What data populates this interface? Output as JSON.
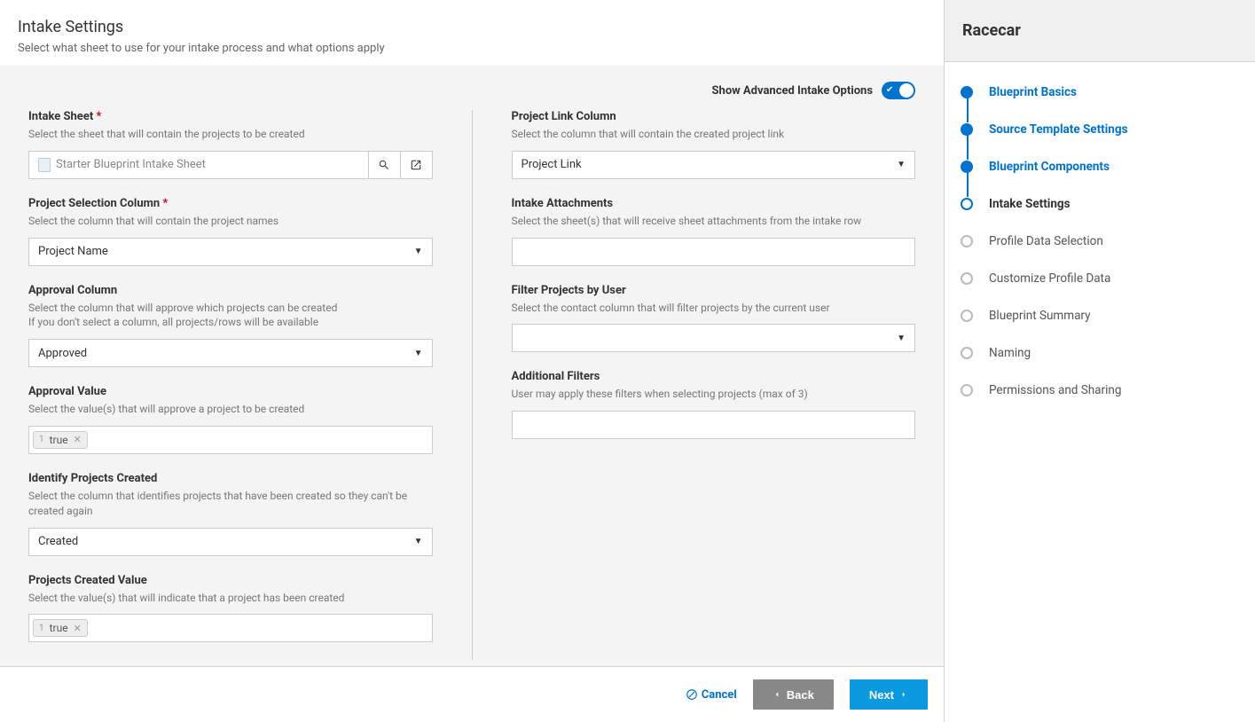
{
  "header": {
    "title": "Intake Settings",
    "subtitle": "Select what sheet to use for your intake process and what options apply"
  },
  "advanced_toggle": {
    "label": "Show Advanced Intake Options",
    "enabled": true
  },
  "left": {
    "intake_sheet": {
      "label": "Intake Sheet",
      "required": true,
      "help": "Select the sheet that will contain the projects to be created",
      "value": "Starter Blueprint Intake Sheet"
    },
    "project_selection": {
      "label": "Project Selection Column",
      "required": true,
      "help": "Select the column that will contain the project names",
      "value": "Project Name"
    },
    "approval_column": {
      "label": "Approval Column",
      "help1": "Select the column that will approve which projects can be created",
      "help2": "If you don't select a column, all projects/rows will be available",
      "value": "Approved"
    },
    "approval_value": {
      "label": "Approval Value",
      "help": "Select the value(s) that will approve a project to be created",
      "tag_num": "1",
      "tag_text": "true"
    },
    "identify_created": {
      "label": "Identify Projects Created",
      "help": "Select the column that identifies projects that have been created so they can't be created again",
      "value": "Created"
    },
    "created_value": {
      "label": "Projects Created Value",
      "help": "Select the value(s) that will indicate that a project has been created",
      "tag_num": "1",
      "tag_text": "true"
    }
  },
  "right": {
    "project_link": {
      "label": "Project Link Column",
      "help": "Select the column that will contain the created project link",
      "value": "Project Link"
    },
    "intake_attachments": {
      "label": "Intake Attachments",
      "help": "Select the sheet(s) that will receive sheet attachments from the intake row"
    },
    "filter_user": {
      "label": "Filter Projects by User",
      "help": "Select the contact column that will filter projects by the current user"
    },
    "additional_filters": {
      "label": "Additional Filters",
      "help": "User may apply these filters when selecting projects (max of 3)"
    }
  },
  "footer": {
    "cancel": "Cancel",
    "back": "Back",
    "next": "Next"
  },
  "sidebar": {
    "title": "Racecar",
    "steps": [
      {
        "label": "Blueprint Basics",
        "state": "done"
      },
      {
        "label": "Source Template Settings",
        "state": "done"
      },
      {
        "label": "Blueprint Components",
        "state": "done"
      },
      {
        "label": "Intake Settings",
        "state": "current"
      },
      {
        "label": "Profile Data Selection",
        "state": "pending"
      },
      {
        "label": "Customize Profile Data",
        "state": "pending"
      },
      {
        "label": "Blueprint Summary",
        "state": "pending"
      },
      {
        "label": "Naming",
        "state": "pending"
      },
      {
        "label": "Permissions and Sharing",
        "state": "pending"
      }
    ]
  }
}
